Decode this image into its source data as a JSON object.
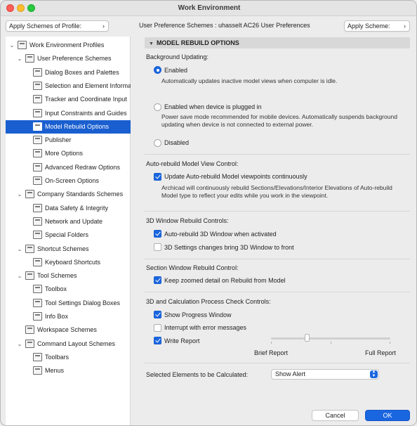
{
  "window": {
    "title": "Work Environment"
  },
  "header": {
    "apply_profile_label": "Apply Schemes of Profile:",
    "apply_scheme_label": "Apply Scheme:",
    "context_text": "User Preference Schemes : uhasselt AC26 User Preferences"
  },
  "tree": [
    {
      "id": "work-environment-profiles",
      "label": "Work Environment Profiles",
      "level": 0,
      "disclosure": "expanded",
      "icon": "profiles-icon"
    },
    {
      "id": "user-preference-schemes",
      "label": "User Preference Schemes",
      "level": 1,
      "disclosure": "expanded",
      "icon": "scheme-icon"
    },
    {
      "id": "dialog-boxes-and-palettes",
      "label": "Dialog Boxes and Palettes",
      "level": 2,
      "icon": "dialog-icon"
    },
    {
      "id": "selection-and-element-information",
      "label": "Selection and Element Informatic",
      "level": 2,
      "icon": "selection-icon"
    },
    {
      "id": "tracker-and-coordinate-input",
      "label": "Tracker and Coordinate Input",
      "level": 2,
      "icon": "xyz-icon"
    },
    {
      "id": "input-constraints-and-guides",
      "label": "Input Constraints and Guides",
      "level": 2,
      "icon": "cursor-icon"
    },
    {
      "id": "model-rebuild-options",
      "label": "Model Rebuild Options",
      "level": 2,
      "icon": "rebuild-icon",
      "selected": true
    },
    {
      "id": "publisher",
      "label": "Publisher",
      "level": 2,
      "icon": "publisher-icon"
    },
    {
      "id": "more-options",
      "label": "More Options",
      "level": 2,
      "icon": "sliders-icon"
    },
    {
      "id": "advanced-redraw-options",
      "label": "Advanced Redraw Options",
      "level": 2,
      "icon": "redraw-icon"
    },
    {
      "id": "on-screen-options",
      "label": "On-Screen Options",
      "level": 2,
      "icon": "screen-icon"
    },
    {
      "id": "company-standards-schemes",
      "label": "Company Standards Schemes",
      "level": 1,
      "disclosure": "expanded",
      "icon": "scheme-icon"
    },
    {
      "id": "data-safety-and-integrity",
      "label": "Data Safety & Integrity",
      "level": 2,
      "icon": "shield-icon"
    },
    {
      "id": "network-and-update",
      "label": "Network and Update",
      "level": 2,
      "icon": "globe-icon"
    },
    {
      "id": "special-folders",
      "label": "Special Folders",
      "level": 2,
      "icon": "folder-icon"
    },
    {
      "id": "shortcut-schemes",
      "label": "Shortcut Schemes",
      "level": 1,
      "disclosure": "expanded",
      "icon": "scheme-icon"
    },
    {
      "id": "keyboard-shortcuts",
      "label": "Keyboard Shortcuts",
      "level": 2,
      "icon": "shortcut-icon"
    },
    {
      "id": "tool-schemes",
      "label": "Tool Schemes",
      "level": 1,
      "disclosure": "expanded",
      "icon": "scheme-icon"
    },
    {
      "id": "toolbox",
      "label": "Toolbox",
      "level": 2,
      "icon": "toolbox-icon"
    },
    {
      "id": "tool-settings-dialog-boxes",
      "label": "Tool Settings Dialog Boxes",
      "level": 2,
      "icon": "tool-settings-icon"
    },
    {
      "id": "info-box",
      "label": "Info Box",
      "level": 2,
      "icon": "infobox-icon"
    },
    {
      "id": "workspace-schemes",
      "label": "Workspace Schemes",
      "level": 1,
      "icon": "scheme-icon"
    },
    {
      "id": "command-layout-schemes",
      "label": "Command Layout Schemes",
      "level": 1,
      "disclosure": "expanded",
      "icon": "scheme-icon"
    },
    {
      "id": "toolbars",
      "label": "Toolbars",
      "level": 2,
      "icon": "toolbars-icon"
    },
    {
      "id": "menus",
      "label": "Menus",
      "level": 2,
      "icon": "menus-icon"
    }
  ],
  "panel": {
    "title": "MODEL REBUILD OPTIONS",
    "background_updating": {
      "heading": "Background Updating:",
      "options": [
        {
          "label": "Enabled",
          "description": "Automatically updates inactive model views when computer is idle.",
          "selected": true
        },
        {
          "label": "Enabled when device is plugged in",
          "description": "Power save mode recommended for mobile devices. Automatically suspends background updating when device is not connected to external power.",
          "selected": false
        },
        {
          "label": "Disabled",
          "description": "",
          "selected": false
        }
      ]
    },
    "auto_rebuild": {
      "heading": "Auto-rebuild Model View Control:",
      "checkbox_label": "Update Auto-rebuild Model viewpoints continuously",
      "checked": true,
      "description": "Archicad will continuously rebuild Sections/Elevations/Interior Elevations of Auto-rebuild Model type to reflect your edits while you work in the viewpoint."
    },
    "window_3d": {
      "heading": "3D Window Rebuild Controls:",
      "options": [
        {
          "label": "Auto-rebuild 3D Window when activated",
          "checked": true
        },
        {
          "label": "3D Settings changes bring 3D Window to front",
          "checked": false
        }
      ]
    },
    "section_window": {
      "heading": "Section Window Rebuild Control:",
      "checkbox_label": "Keep zoomed detail on Rebuild from Model",
      "checked": true
    },
    "process_check": {
      "heading": "3D and Calculation Process Check Controls:",
      "options": [
        {
          "label": "Show Progress Window",
          "checked": true
        },
        {
          "label": "Interrupt with error messages",
          "checked": false
        },
        {
          "label": "Write Report",
          "checked": true
        }
      ],
      "slider_min_label": "Brief Report",
      "slider_max_label": "Full Report",
      "slider_value": 0.3
    },
    "selected_elements": {
      "label": "Selected Elements to be Calculated:",
      "value": "Show Alert"
    }
  },
  "footer": {
    "cancel_label": "Cancel",
    "ok_label": "OK"
  }
}
